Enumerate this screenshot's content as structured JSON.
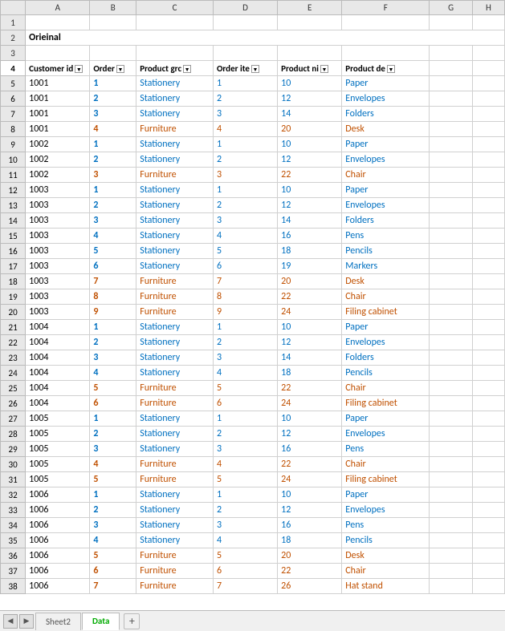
{
  "title": "Orieinal",
  "columns": {
    "letters": [
      "",
      "A",
      "B",
      "C",
      "D",
      "E",
      "F",
      "G",
      "H"
    ],
    "headers": [
      "",
      "Customer id",
      "Order",
      "Product grc",
      "Order ite",
      "Product ni",
      "Product de",
      "G",
      "H"
    ]
  },
  "rows": [
    {
      "num": 1,
      "a": "",
      "b": "",
      "c": "",
      "d": "",
      "e": "",
      "f": "",
      "g": "",
      "h": ""
    },
    {
      "num": 2,
      "a": "Orieinal",
      "b": "",
      "c": "",
      "d": "",
      "e": "",
      "f": "",
      "g": "",
      "h": ""
    },
    {
      "num": 3,
      "a": "",
      "b": "",
      "c": "",
      "d": "",
      "e": "",
      "f": "",
      "g": "",
      "h": ""
    },
    {
      "num": 4,
      "a": "Customer id",
      "aFilter": true,
      "b": "Order",
      "bFilter": true,
      "c": "Product grc",
      "cFilter": true,
      "d": "Order ite",
      "dFilter": true,
      "e": "Product ni",
      "eFilter": true,
      "f": "Product de",
      "fFilter": true,
      "g": "",
      "h": "",
      "isHeader": true
    },
    {
      "num": 5,
      "a": "1001",
      "b": "1",
      "c": "Stationery",
      "d": "1",
      "e": "10",
      "f": "Paper"
    },
    {
      "num": 6,
      "a": "1001",
      "b": "2",
      "c": "Stationery",
      "d": "2",
      "e": "12",
      "f": "Envelopes"
    },
    {
      "num": 7,
      "a": "1001",
      "b": "3",
      "c": "Stationery",
      "d": "3",
      "e": "14",
      "f": "Folders"
    },
    {
      "num": 8,
      "a": "1001",
      "b": "4",
      "c": "Furniture",
      "d": "4",
      "e": "20",
      "f": "Desk"
    },
    {
      "num": 9,
      "a": "1002",
      "b": "1",
      "c": "Stationery",
      "d": "1",
      "e": "10",
      "f": "Paper"
    },
    {
      "num": 10,
      "a": "1002",
      "b": "2",
      "c": "Stationery",
      "d": "2",
      "e": "12",
      "f": "Envelopes"
    },
    {
      "num": 11,
      "a": "1002",
      "b": "3",
      "c": "Furniture",
      "d": "3",
      "e": "22",
      "f": "Chair"
    },
    {
      "num": 12,
      "a": "1003",
      "b": "1",
      "c": "Stationery",
      "d": "1",
      "e": "10",
      "f": "Paper"
    },
    {
      "num": 13,
      "a": "1003",
      "b": "2",
      "c": "Stationery",
      "d": "2",
      "e": "12",
      "f": "Envelopes"
    },
    {
      "num": 14,
      "a": "1003",
      "b": "3",
      "c": "Stationery",
      "d": "3",
      "e": "14",
      "f": "Folders"
    },
    {
      "num": 15,
      "a": "1003",
      "b": "4",
      "c": "Stationery",
      "d": "4",
      "e": "16",
      "f": "Pens"
    },
    {
      "num": 16,
      "a": "1003",
      "b": "5",
      "c": "Stationery",
      "d": "5",
      "e": "18",
      "f": "Pencils"
    },
    {
      "num": 17,
      "a": "1003",
      "b": "6",
      "c": "Stationery",
      "d": "6",
      "e": "19",
      "f": "Markers"
    },
    {
      "num": 18,
      "a": "1003",
      "b": "7",
      "c": "Furniture",
      "d": "7",
      "e": "20",
      "f": "Desk"
    },
    {
      "num": 19,
      "a": "1003",
      "b": "8",
      "c": "Furniture",
      "d": "8",
      "e": "22",
      "f": "Chair"
    },
    {
      "num": 20,
      "a": "1003",
      "b": "9",
      "c": "Furniture",
      "d": "9",
      "e": "24",
      "f": "Filing cabinet"
    },
    {
      "num": 21,
      "a": "1004",
      "b": "1",
      "c": "Stationery",
      "d": "1",
      "e": "10",
      "f": "Paper"
    },
    {
      "num": 22,
      "a": "1004",
      "b": "2",
      "c": "Stationery",
      "d": "2",
      "e": "12",
      "f": "Envelopes"
    },
    {
      "num": 23,
      "a": "1004",
      "b": "3",
      "c": "Stationery",
      "d": "3",
      "e": "14",
      "f": "Folders"
    },
    {
      "num": 24,
      "a": "1004",
      "b": "4",
      "c": "Stationery",
      "d": "4",
      "e": "18",
      "f": "Pencils"
    },
    {
      "num": 25,
      "a": "1004",
      "b": "5",
      "c": "Furniture",
      "d": "5",
      "e": "22",
      "f": "Chair"
    },
    {
      "num": 26,
      "a": "1004",
      "b": "6",
      "c": "Furniture",
      "d": "6",
      "e": "24",
      "f": "Filing cabinet"
    },
    {
      "num": 27,
      "a": "1005",
      "b": "1",
      "c": "Stationery",
      "d": "1",
      "e": "10",
      "f": "Paper"
    },
    {
      "num": 28,
      "a": "1005",
      "b": "2",
      "c": "Stationery",
      "d": "2",
      "e": "12",
      "f": "Envelopes"
    },
    {
      "num": 29,
      "a": "1005",
      "b": "3",
      "c": "Stationery",
      "d": "3",
      "e": "16",
      "f": "Pens"
    },
    {
      "num": 30,
      "a": "1005",
      "b": "4",
      "c": "Furniture",
      "d": "4",
      "e": "22",
      "f": "Chair"
    },
    {
      "num": 31,
      "a": "1005",
      "b": "5",
      "c": "Furniture",
      "d": "5",
      "e": "24",
      "f": "Filing cabinet"
    },
    {
      "num": 32,
      "a": "1006",
      "b": "1",
      "c": "Stationery",
      "d": "1",
      "e": "10",
      "f": "Paper"
    },
    {
      "num": 33,
      "a": "1006",
      "b": "2",
      "c": "Stationery",
      "d": "2",
      "e": "12",
      "f": "Envelopes"
    },
    {
      "num": 34,
      "a": "1006",
      "b": "3",
      "c": "Stationery",
      "d": "3",
      "e": "16",
      "f": "Pens"
    },
    {
      "num": 35,
      "a": "1006",
      "b": "4",
      "c": "Stationery",
      "d": "4",
      "e": "18",
      "f": "Pencils"
    },
    {
      "num": 36,
      "a": "1006",
      "b": "5",
      "c": "Furniture",
      "d": "5",
      "e": "20",
      "f": "Desk"
    },
    {
      "num": 37,
      "a": "1006",
      "b": "6",
      "c": "Furniture",
      "d": "6",
      "e": "22",
      "f": "Chair"
    },
    {
      "num": 38,
      "a": "1006",
      "b": "7",
      "c": "Furniture",
      "d": "7",
      "e": "26",
      "f": "Hat stand"
    }
  ],
  "tabs": [
    {
      "label": "Sheet2",
      "active": false
    },
    {
      "label": "Data",
      "active": true
    }
  ],
  "colors": {
    "stationery": "#0070c0",
    "furniture": "#c05000",
    "highlight_bg": "#dce6f1"
  }
}
